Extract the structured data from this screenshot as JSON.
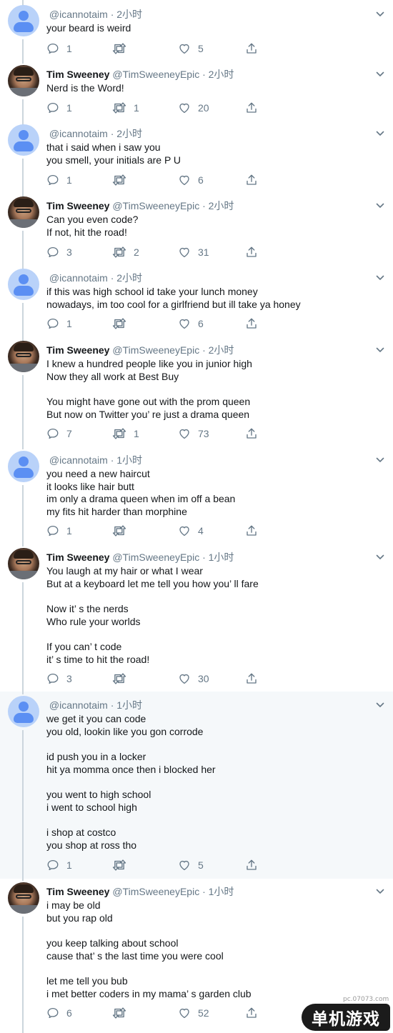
{
  "colors": {
    "accent": "#1da1f2",
    "text": "#14171a",
    "muted": "#657786",
    "thread_line": "#ccd6dd",
    "highlight_bg": "#f5f8fa"
  },
  "tweets": [
    {
      "name": "",
      "handle": "@icannotaim",
      "time": "2小时",
      "text": "your beard is weird",
      "reply": "1",
      "retweet": "",
      "like": "5",
      "avatar": "default-avatar"
    },
    {
      "name": "Tim Sweeney",
      "handle": "@TimSweeneyEpic",
      "time": "2小时",
      "text": "Nerd is the Word!",
      "reply": "1",
      "retweet": "1",
      "like": "20",
      "avatar": "tim-avatar"
    },
    {
      "name": "",
      "handle": "@icannotaim",
      "time": "2小时",
      "text": "that i said when i saw you\nyou smell, your initials are P U",
      "reply": "1",
      "retweet": "",
      "like": "6",
      "avatar": "default-avatar"
    },
    {
      "name": "Tim Sweeney",
      "handle": "@TimSweeneyEpic",
      "time": "2小时",
      "text": "Can you even code?\nIf not, hit the road!",
      "reply": "3",
      "retweet": "2",
      "like": "31",
      "avatar": "tim-avatar"
    },
    {
      "name": "",
      "handle": "@icannotaim",
      "time": "2小时",
      "text": "if this was high school id take your lunch money\nnowadays, im too cool for a girlfriend but ill take ya honey",
      "reply": "1",
      "retweet": "",
      "like": "6",
      "avatar": "default-avatar"
    },
    {
      "name": "Tim Sweeney",
      "handle": "@TimSweeneyEpic",
      "time": "2小时",
      "text": "I knew a hundred people like you in junior high\nNow they all work at Best Buy\n\nYou might have gone out with the prom queen\nBut now on Twitter you’ re just a drama queen",
      "reply": "7",
      "retweet": "1",
      "like": "73",
      "avatar": "tim-avatar"
    },
    {
      "name": "",
      "handle": "@icannotaim",
      "time": "1小时",
      "text": "you need a new haircut\nit looks like hair butt\nim only a drama queen when im off a bean\nmy fits hit harder than morphine",
      "reply": "1",
      "retweet": "",
      "like": "4",
      "avatar": "default-avatar"
    },
    {
      "name": "Tim Sweeney",
      "handle": "@TimSweeneyEpic",
      "time": "1小时",
      "text": "You laugh at my hair or what I wear\nBut at a keyboard let me tell you how you’ ll fare\n\nNow it’ s the nerds\nWho rule your worlds\n\nIf you can’ t code\nit’ s time to hit the road!",
      "reply": "3",
      "retweet": "",
      "like": "30",
      "avatar": "tim-avatar"
    },
    {
      "name": "",
      "handle": "@icannotaim",
      "time": "1小时",
      "text": "we get it you can code\nyou old, lookin like you gon corrode\n\nid push you in a locker\nhit ya momma once then i blocked her\n\nyou went to high school\ni went to school high\n\ni shop at costco\nyou shop at ross tho",
      "reply": "1",
      "retweet": "",
      "like": "5",
      "avatar": "default-avatar"
    },
    {
      "name": "Tim Sweeney",
      "handle": "@TimSweeneyEpic",
      "time": "1小时",
      "text": "i may be old\nbut you rap old\n\nyou keep talking about school\ncause that’ s the last time you were cool\n\nlet me tell you bub\ni met better coders in my mama’ s garden club",
      "reply": "6",
      "retweet": "",
      "like": "52",
      "avatar": "tim-avatar"
    }
  ],
  "watermark": {
    "main": "单机游戏",
    "small": "pc.07073.com"
  }
}
